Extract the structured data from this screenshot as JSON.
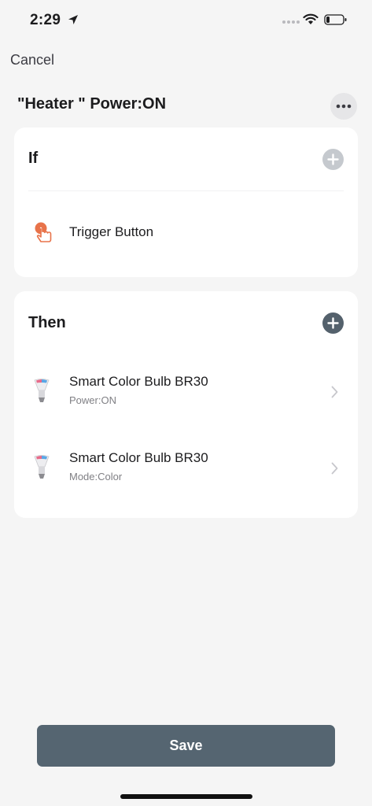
{
  "status_bar": {
    "time": "2:29"
  },
  "nav": {
    "cancel_label": "Cancel"
  },
  "scene": {
    "title": "\"Heater \" Power:ON"
  },
  "if_section": {
    "heading": "If",
    "trigger": {
      "label": "Trigger Button",
      "icon": "tap-finger-icon"
    }
  },
  "then_section": {
    "heading": "Then",
    "actions": [
      {
        "title": "Smart Color Bulb BR30",
        "subtitle": "Power:ON",
        "icon": "bulb-icon"
      },
      {
        "title": "Smart Color Bulb BR30",
        "subtitle": "Mode:Color",
        "icon": "bulb-icon"
      }
    ]
  },
  "footer": {
    "save_label": "Save"
  },
  "colors": {
    "background": "#f5f5f5",
    "card": "#ffffff",
    "save_button": "#556571",
    "add_enabled": "#54616c",
    "add_disabled": "#c5c9ce",
    "trigger_accent": "#e8734a"
  }
}
